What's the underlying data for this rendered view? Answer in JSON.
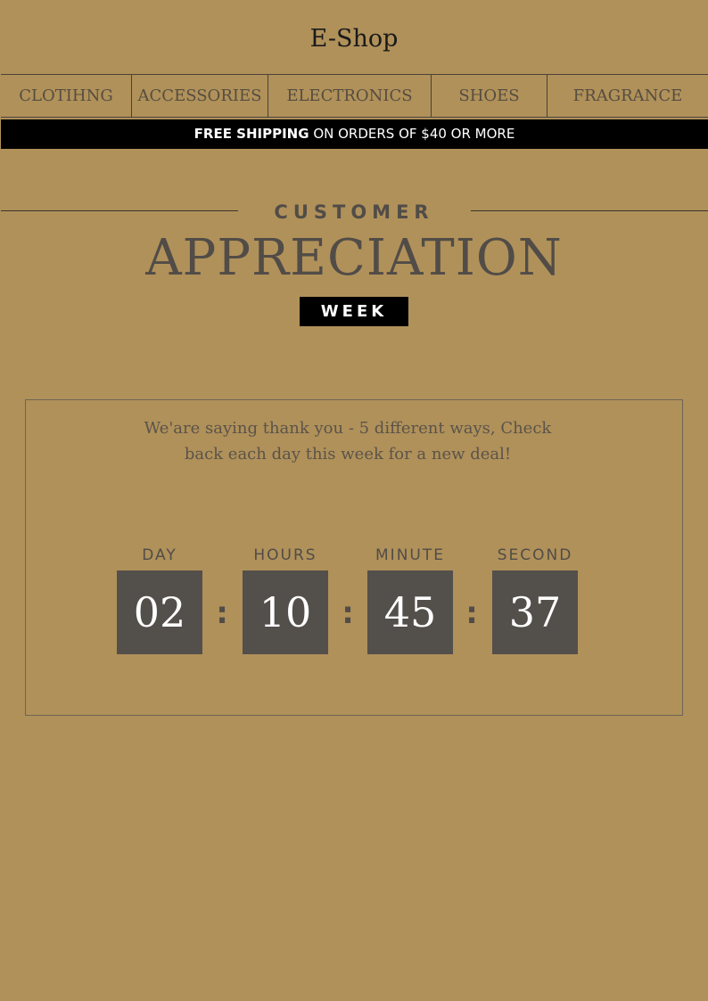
{
  "header": {
    "shop_name": "E-Shop"
  },
  "nav": {
    "items": [
      {
        "label": "CLOTIHNG"
      },
      {
        "label": "ACCESSORIES"
      },
      {
        "label": "ELECTRONICS"
      },
      {
        "label": "SHOES"
      },
      {
        "label": "FRAGRANCE"
      }
    ]
  },
  "shipping": {
    "bold": "FREE SHIPPING",
    "rest": " ON ORDERS OF  $40 OR MORE"
  },
  "hero": {
    "kicker": "CUSTOMER",
    "title": "APPRECIATION",
    "badge": "WEEK"
  },
  "deal": {
    "line1": "We'are saying thank you - 5 different ways, Check",
    "line2": "back each day this week for a new deal!"
  },
  "countdown": {
    "separator": ":",
    "units": [
      {
        "label": "DAY",
        "value": "02"
      },
      {
        "label": "HOURS",
        "value": "10"
      },
      {
        "label": "MINUTE",
        "value": "45"
      },
      {
        "label": "SECOND",
        "value": "37"
      }
    ]
  },
  "colors": {
    "background": "#b0915a",
    "dark_text": "#514c47",
    "tile": "#534f4b",
    "bar": "#000000"
  }
}
